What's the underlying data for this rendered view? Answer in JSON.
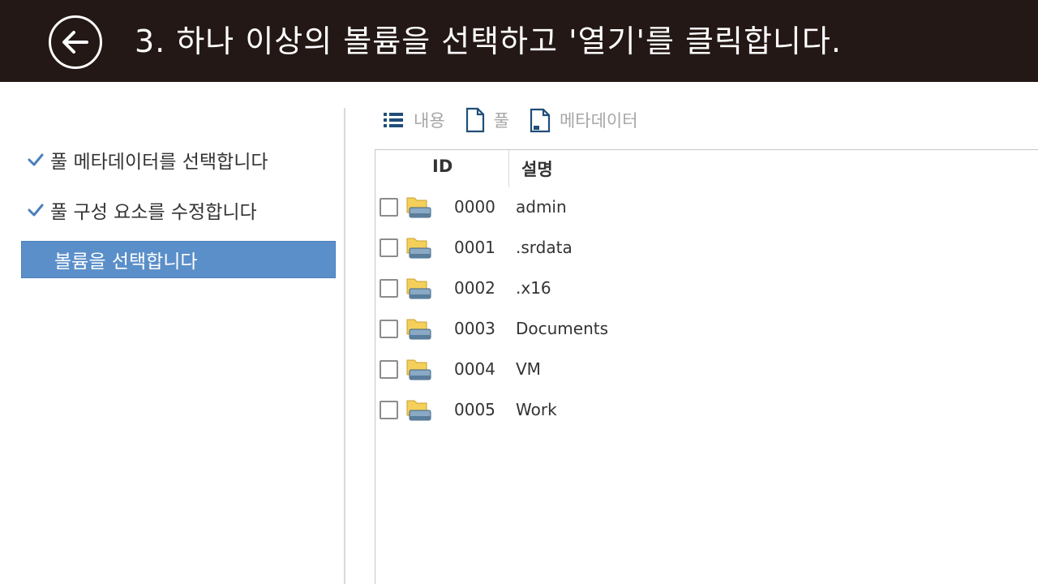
{
  "banner": {
    "title": "3. 하나 이상의 볼륨을 선택하고 '열기'를 클릭합니다."
  },
  "steps": [
    {
      "label": "풀 메타데이터를 선택합니다",
      "done": true
    },
    {
      "label": "풀 구성 요소를 수정합니다",
      "done": true
    },
    {
      "label": "볼륨을 선택합니다",
      "active": true
    }
  ],
  "toolbar": {
    "contents_label": "내용",
    "pool_label": "풀",
    "metadata_label": "메타데이터"
  },
  "table": {
    "headers": {
      "id": "ID",
      "desc": "설명"
    },
    "rows": [
      {
        "id": "0000",
        "desc": "admin"
      },
      {
        "id": "0001",
        "desc": ".srdata"
      },
      {
        "id": "0002",
        "desc": ".x16"
      },
      {
        "id": "0003",
        "desc": "Documents"
      },
      {
        "id": "0004",
        "desc": "VM"
      },
      {
        "id": "0005",
        "desc": "Work"
      }
    ]
  },
  "colors": {
    "banner_bg": "#231815",
    "active_step": "#5b8fc9",
    "check": "#4a7fbc",
    "toolbar_icon": "#1f4e79"
  }
}
